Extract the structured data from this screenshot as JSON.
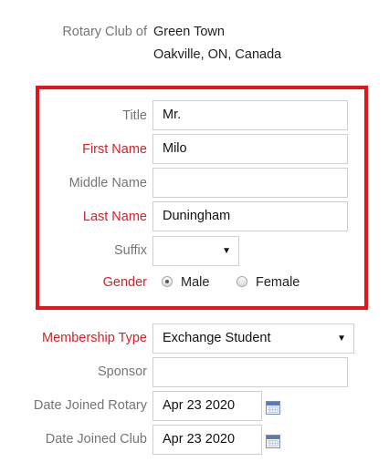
{
  "club": {
    "label": "Rotary Club of",
    "name": "Green Town",
    "location": "Oakville, ON, Canada"
  },
  "form": {
    "title": {
      "label": "Title",
      "value": "Mr."
    },
    "first_name": {
      "label": "First Name",
      "value": "Milo"
    },
    "middle_name": {
      "label": "Middle Name",
      "value": ""
    },
    "last_name": {
      "label": "Last Name",
      "value": "Duningham"
    },
    "suffix": {
      "label": "Suffix",
      "value": ""
    },
    "gender": {
      "label": "Gender",
      "options": [
        "Male",
        "Female"
      ],
      "selected": "Male"
    },
    "membership_type": {
      "label": "Membership Type",
      "value": "Exchange Student"
    },
    "sponsor": {
      "label": "Sponsor",
      "value": ""
    },
    "date_joined_rotary": {
      "label": "Date Joined Rotary",
      "value": "Apr 23 2020"
    },
    "date_joined_club": {
      "label": "Date Joined Club",
      "value": "Apr 23 2020"
    }
  },
  "colors": {
    "required_label": "#d2232a",
    "highlight_border": "#e3141c",
    "label": "#757575"
  },
  "icons": [
    "caret-down-icon",
    "calendar-icon"
  ]
}
